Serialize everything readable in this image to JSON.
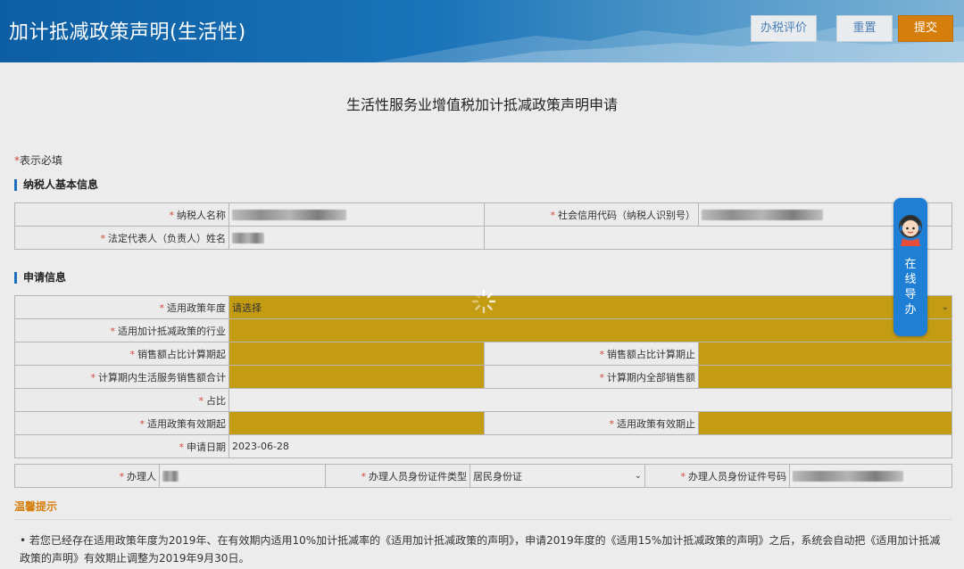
{
  "header": {
    "title": "加计抵减政策声明(生活性)",
    "eval_label": "办税评价",
    "reset_label": "重置",
    "submit_label": "提交"
  },
  "page": {
    "heading": "生活性服务业增值税加计抵减政策声明申请",
    "required_note": "表示必填",
    "required_star": "*"
  },
  "section_basic": {
    "title": "纳税人基本信息",
    "taxpayer_name_label": "纳税人名称",
    "credit_code_label": "社会信用代码（纳税人识别号）",
    "legal_rep_label": "法定代表人（负责人）姓名"
  },
  "section_apply": {
    "title": "申请信息",
    "policy_year_label": "适用政策年度",
    "policy_year_value": "请选择",
    "industry_label": "适用加计抵减政策的行业",
    "sales_start_label": "销售额占比计算期起",
    "sales_end_label": "销售额占比计算期止",
    "service_sales_label": "计算期内生活服务销售额合计",
    "total_sales_label": "计算期内全部销售额",
    "ratio_label": "占比",
    "valid_start_label": "适用政策有效期起",
    "valid_end_label": "适用政策有效期止",
    "apply_date_label": "申请日期",
    "apply_date_value": "2023-06-28",
    "handler_label": "办理人",
    "id_type_label": "办理人员身份证件类型",
    "id_type_value": "居民身份证",
    "id_no_label": "办理人员身份证件号码"
  },
  "tips": {
    "title": "温馨提示",
    "item1": "若您已经存在适用政策年度为2019年、在有效期内适用10%加计抵减率的《适用加计抵减政策的声明》，申请2019年度的《适用15%加计抵减政策的声明》之后，系统会自动把《适用加计抵减政策的声明》有效期止调整为2019年9月30日。"
  },
  "guide": {
    "text": "在线导办"
  },
  "colors": {
    "header_blue": "#1a73b8",
    "submit_orange": "#d67e0c",
    "field_yellow": "#c49c14",
    "required_red": "#d04a3c"
  }
}
